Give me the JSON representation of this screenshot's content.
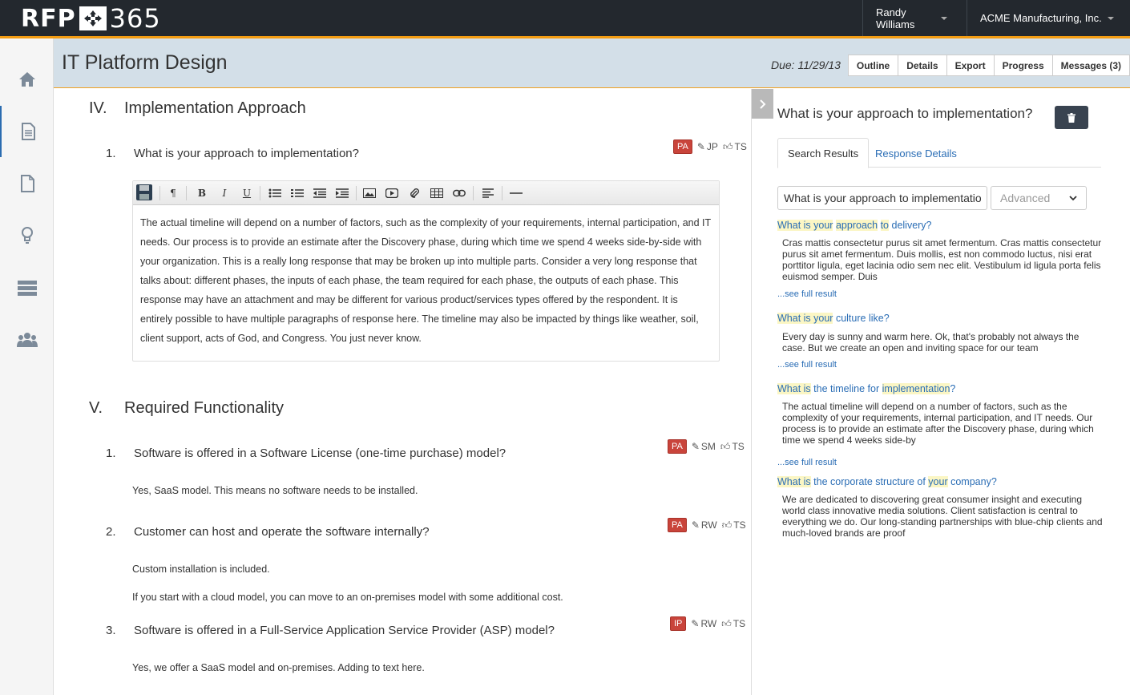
{
  "header": {
    "logo_left": "RFP",
    "logo_right": "365",
    "user_name": "Randy Williams",
    "org_name": "ACME Manufacturing, Inc."
  },
  "nav": {
    "icons": [
      "home-icon",
      "document-icon",
      "file-icon",
      "lightbulb-icon",
      "server-icon",
      "team-icon"
    ]
  },
  "page": {
    "title": "IT Platform Design",
    "due": "Due: 11/29/13",
    "tabs": [
      "Outline",
      "Details",
      "Export",
      "Progress",
      "Messages (3)"
    ]
  },
  "sections": [
    {
      "num": "IV.",
      "title": "Implementation Approach",
      "questions": [
        {
          "num": "1.",
          "text": "What is your approach to implementation?",
          "badge": "PA",
          "editor": "JP",
          "reviewer": "TS",
          "answer": "The actual timeline will depend on a number of factors, such as the complexity of your requirements, internal participation, and IT needs. Our process is to provide an estimate after the Discovery phase, during which time we spend 4 weeks side-by-side with your organization. This is a really long response that may be broken up into multiple parts. Consider a very long response that talks about: different phases, the inputs of each phase, the team required for each phase, the outputs of each phase. This response may have an attachment and may be different for various product/services types offered by the respondent. It is entirely possible to have multiple paragraphs of response here. The timeline may also be impacted by things like weather, soil, client support, acts of God, and Congress. You just never know."
        }
      ]
    },
    {
      "num": "V.",
      "title": "Required Functionality",
      "questions": [
        {
          "num": "1.",
          "text": "Software is offered in a Software License (one-time purchase) model?",
          "badge": "PA",
          "editor": "SM",
          "reviewer": "TS",
          "answer": "Yes, SaaS model. This means no software needs to be installed."
        },
        {
          "num": "2.",
          "text": "Customer can host and operate the software internally?",
          "badge": "PA",
          "editor": "RW",
          "reviewer": "TS",
          "answer": "Custom installation is included.",
          "answer2": "If you start with a cloud model, you can move to an on-premises model with some additional cost."
        },
        {
          "num": "3.",
          "text": "Software is offered in a Full-Service Application Service Provider (ASP) model?",
          "badge": "IP",
          "editor": "RW",
          "reviewer": "TS",
          "answer": "Yes, we offer a SaaS model and on-premises.  Adding to text here."
        }
      ]
    }
  ],
  "right_panel": {
    "title": "What is your approach to implementation?",
    "tabs": [
      "Search Results",
      "Response Details"
    ],
    "search_value": "What is your approach to implementation?",
    "advanced_label": "Advanced",
    "see_full": "...see full result",
    "results": [
      {
        "title_parts": [
          {
            "t": "What is ",
            "hl": true
          },
          {
            "t": "your",
            "hl": true
          },
          {
            "t": " ",
            "hl": false
          },
          {
            "t": "approach",
            "hl": true
          },
          {
            "t": " ",
            "hl": false
          },
          {
            "t": "to",
            "hl": true
          },
          {
            "t": " delivery?",
            "hl": false
          }
        ],
        "snippet": "Cras mattis consectetur purus sit amet fermentum. Cras mattis consectetur purus sit amet fermentum. Duis mollis, est non commodo luctus, nisi erat porttitor ligula, eget lacinia odio sem nec elit. Vestibulum id ligula porta felis euismod semper. Duis"
      },
      {
        "title_parts": [
          {
            "t": "What is ",
            "hl": true
          },
          {
            "t": "your",
            "hl": true
          },
          {
            "t": " culture like?",
            "hl": false
          }
        ],
        "snippet": "Every day is sunny and warm here. Ok, that's probably not always the case. But we create an open and inviting space for our team"
      },
      {
        "title_parts": [
          {
            "t": "What is",
            "hl": true
          },
          {
            "t": " the timeline for ",
            "hl": false
          },
          {
            "t": "implementation",
            "hl": true
          },
          {
            "t": "?",
            "hl": false
          }
        ],
        "snippet": "The actual timeline will depend on a number of factors, such as the complexity of your requirements, internal participation, and IT needs. Our process is to provide an estimate after the Discovery phase, during which time we spend 4 weeks side-by"
      },
      {
        "title_parts": [
          {
            "t": "What is",
            "hl": true
          },
          {
            "t": " the corporate structure of ",
            "hl": false
          },
          {
            "t": "your",
            "hl": true
          },
          {
            "t": " company?",
            "hl": false
          }
        ],
        "snippet": "We are dedicated to discovering great consumer insight and executing world class innovative media solutions. Client satisfaction is central to everything we do. Our long-standing partnerships with blue-chip clients and much-loved brands are proof"
      }
    ]
  },
  "colors": {
    "topbar": "#23282e",
    "accent": "#f39c12",
    "header_bg": "#d3dfe8",
    "badge_red": "#c9443b",
    "link_blue": "#2a6db5",
    "highlight": "#fbf6c4"
  }
}
